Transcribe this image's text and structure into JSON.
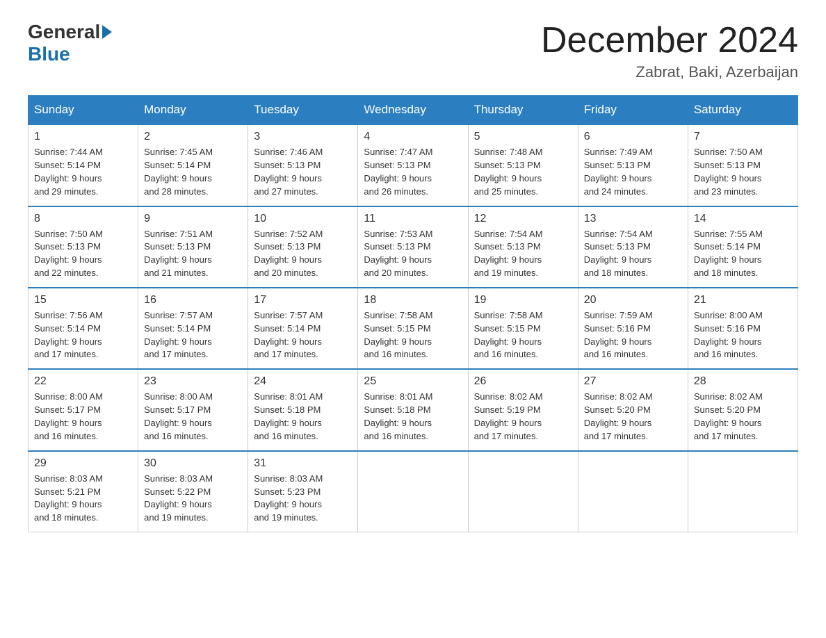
{
  "logo": {
    "general": "General",
    "blue": "Blue"
  },
  "title": {
    "month_year": "December 2024",
    "location": "Zabrat, Baki, Azerbaijan"
  },
  "weekdays": [
    "Sunday",
    "Monday",
    "Tuesday",
    "Wednesday",
    "Thursday",
    "Friday",
    "Saturday"
  ],
  "weeks": [
    [
      {
        "day": "1",
        "sunrise": "7:44 AM",
        "sunset": "5:14 PM",
        "daylight": "9 hours and 29 minutes."
      },
      {
        "day": "2",
        "sunrise": "7:45 AM",
        "sunset": "5:14 PM",
        "daylight": "9 hours and 28 minutes."
      },
      {
        "day": "3",
        "sunrise": "7:46 AM",
        "sunset": "5:13 PM",
        "daylight": "9 hours and 27 minutes."
      },
      {
        "day": "4",
        "sunrise": "7:47 AM",
        "sunset": "5:13 PM",
        "daylight": "9 hours and 26 minutes."
      },
      {
        "day": "5",
        "sunrise": "7:48 AM",
        "sunset": "5:13 PM",
        "daylight": "9 hours and 25 minutes."
      },
      {
        "day": "6",
        "sunrise": "7:49 AM",
        "sunset": "5:13 PM",
        "daylight": "9 hours and 24 minutes."
      },
      {
        "day": "7",
        "sunrise": "7:50 AM",
        "sunset": "5:13 PM",
        "daylight": "9 hours and 23 minutes."
      }
    ],
    [
      {
        "day": "8",
        "sunrise": "7:50 AM",
        "sunset": "5:13 PM",
        "daylight": "9 hours and 22 minutes."
      },
      {
        "day": "9",
        "sunrise": "7:51 AM",
        "sunset": "5:13 PM",
        "daylight": "9 hours and 21 minutes."
      },
      {
        "day": "10",
        "sunrise": "7:52 AM",
        "sunset": "5:13 PM",
        "daylight": "9 hours and 20 minutes."
      },
      {
        "day": "11",
        "sunrise": "7:53 AM",
        "sunset": "5:13 PM",
        "daylight": "9 hours and 20 minutes."
      },
      {
        "day": "12",
        "sunrise": "7:54 AM",
        "sunset": "5:13 PM",
        "daylight": "9 hours and 19 minutes."
      },
      {
        "day": "13",
        "sunrise": "7:54 AM",
        "sunset": "5:13 PM",
        "daylight": "9 hours and 18 minutes."
      },
      {
        "day": "14",
        "sunrise": "7:55 AM",
        "sunset": "5:14 PM",
        "daylight": "9 hours and 18 minutes."
      }
    ],
    [
      {
        "day": "15",
        "sunrise": "7:56 AM",
        "sunset": "5:14 PM",
        "daylight": "9 hours and 17 minutes."
      },
      {
        "day": "16",
        "sunrise": "7:57 AM",
        "sunset": "5:14 PM",
        "daylight": "9 hours and 17 minutes."
      },
      {
        "day": "17",
        "sunrise": "7:57 AM",
        "sunset": "5:14 PM",
        "daylight": "9 hours and 17 minutes."
      },
      {
        "day": "18",
        "sunrise": "7:58 AM",
        "sunset": "5:15 PM",
        "daylight": "9 hours and 16 minutes."
      },
      {
        "day": "19",
        "sunrise": "7:58 AM",
        "sunset": "5:15 PM",
        "daylight": "9 hours and 16 minutes."
      },
      {
        "day": "20",
        "sunrise": "7:59 AM",
        "sunset": "5:16 PM",
        "daylight": "9 hours and 16 minutes."
      },
      {
        "day": "21",
        "sunrise": "8:00 AM",
        "sunset": "5:16 PM",
        "daylight": "9 hours and 16 minutes."
      }
    ],
    [
      {
        "day": "22",
        "sunrise": "8:00 AM",
        "sunset": "5:17 PM",
        "daylight": "9 hours and 16 minutes."
      },
      {
        "day": "23",
        "sunrise": "8:00 AM",
        "sunset": "5:17 PM",
        "daylight": "9 hours and 16 minutes."
      },
      {
        "day": "24",
        "sunrise": "8:01 AM",
        "sunset": "5:18 PM",
        "daylight": "9 hours and 16 minutes."
      },
      {
        "day": "25",
        "sunrise": "8:01 AM",
        "sunset": "5:18 PM",
        "daylight": "9 hours and 16 minutes."
      },
      {
        "day": "26",
        "sunrise": "8:02 AM",
        "sunset": "5:19 PM",
        "daylight": "9 hours and 17 minutes."
      },
      {
        "day": "27",
        "sunrise": "8:02 AM",
        "sunset": "5:20 PM",
        "daylight": "9 hours and 17 minutes."
      },
      {
        "day": "28",
        "sunrise": "8:02 AM",
        "sunset": "5:20 PM",
        "daylight": "9 hours and 17 minutes."
      }
    ],
    [
      {
        "day": "29",
        "sunrise": "8:03 AM",
        "sunset": "5:21 PM",
        "daylight": "9 hours and 18 minutes."
      },
      {
        "day": "30",
        "sunrise": "8:03 AM",
        "sunset": "5:22 PM",
        "daylight": "9 hours and 19 minutes."
      },
      {
        "day": "31",
        "sunrise": "8:03 AM",
        "sunset": "5:23 PM",
        "daylight": "9 hours and 19 minutes."
      },
      null,
      null,
      null,
      null
    ]
  ],
  "labels": {
    "sunrise": "Sunrise:",
    "sunset": "Sunset:",
    "daylight": "Daylight:"
  }
}
